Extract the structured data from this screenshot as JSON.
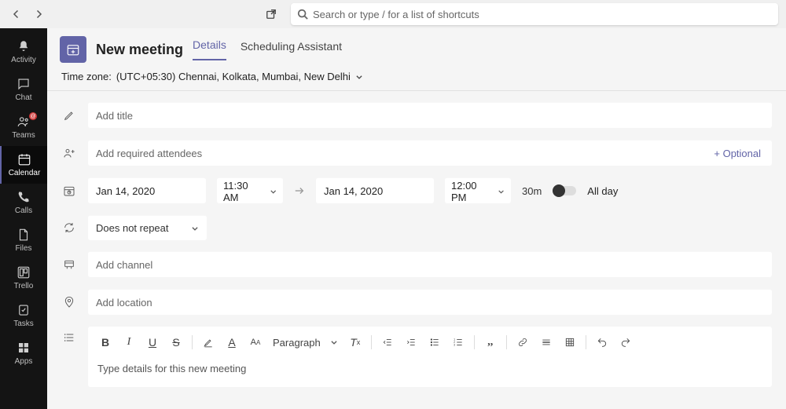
{
  "search": {
    "placeholder": "Search or type / for a list of shortcuts"
  },
  "sidebar": {
    "items": [
      {
        "label": "Activity"
      },
      {
        "label": "Chat"
      },
      {
        "label": "Teams"
      },
      {
        "label": "Calendar"
      },
      {
        "label": "Calls"
      },
      {
        "label": "Files"
      },
      {
        "label": "Trello"
      },
      {
        "label": "Tasks"
      },
      {
        "label": "Apps"
      }
    ]
  },
  "hdr": {
    "title": "New meeting",
    "tabs": {
      "details": "Details",
      "scheduling": "Scheduling Assistant"
    }
  },
  "tz": {
    "label": "Time zone:",
    "value": "(UTC+05:30) Chennai, Kolkata, Mumbai, New Delhi"
  },
  "form": {
    "title_placeholder": "Add title",
    "attendees_placeholder": "Add required attendees",
    "optional_link": "+ Optional",
    "start_date": "Jan 14, 2020",
    "start_time": "11:30 AM",
    "end_date": "Jan 14, 2020",
    "end_time": "12:00 PM",
    "duration": "30m",
    "allday_label": "All day",
    "recurrence": "Does not repeat",
    "channel_placeholder": "Add channel",
    "location_placeholder": "Add location"
  },
  "editor": {
    "paragraph_label": "Paragraph",
    "body_placeholder": "Type details for this new meeting"
  }
}
